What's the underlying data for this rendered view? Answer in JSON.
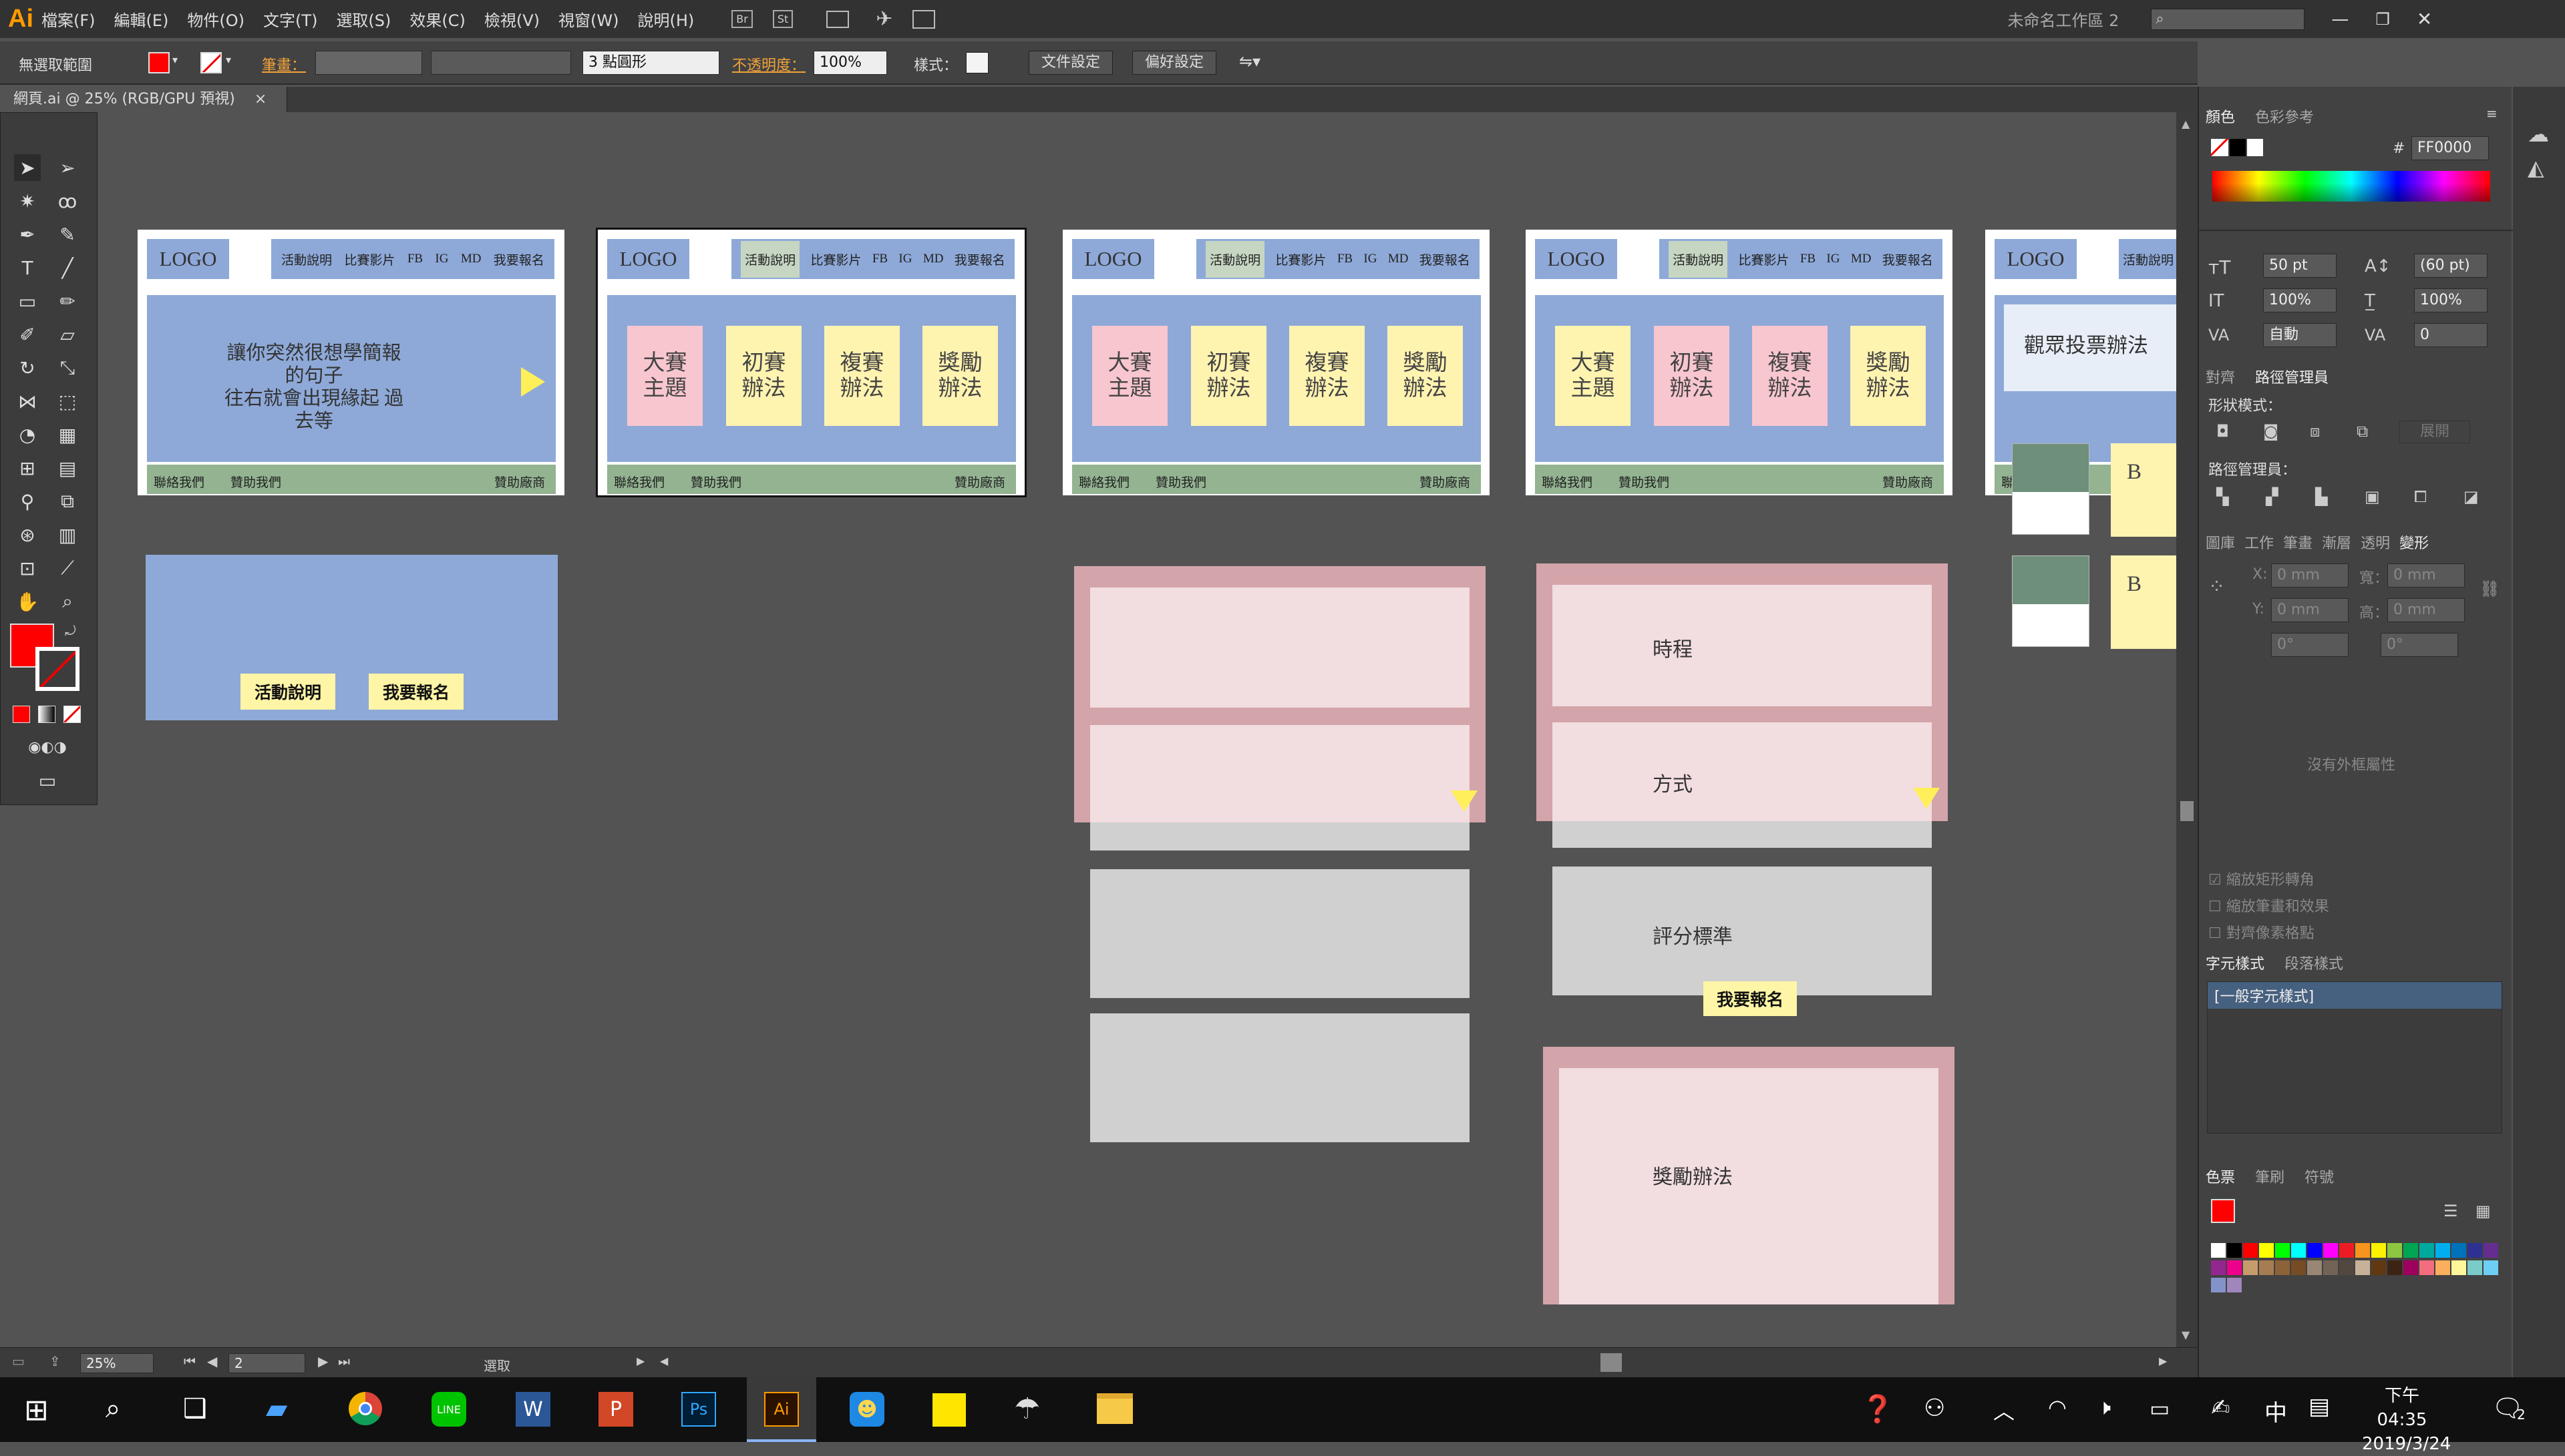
{
  "app": {
    "logo": "Ai",
    "doc_tab": "網頁.ai @ 25% (RGB/GPU 預視)",
    "tab_close": "×",
    "workspace": "未命名工作區 2"
  },
  "menus": [
    "檔案(F)",
    "編輯(E)",
    "物件(O)",
    "文字(T)",
    "選取(S)",
    "效果(C)",
    "檢視(V)",
    "視窗(W)",
    "說明(H)"
  ],
  "menubar_icons": {
    "br": "Br",
    "st": "St"
  },
  "control": {
    "selection": "無選取範圍",
    "stroke_label": "筆畫：",
    "brush": "3 點圓形",
    "opacity_label": "不透明度：",
    "opacity": "100%",
    "style_label": "樣式：",
    "doc_settings": "文件設定",
    "prefs": "偏好設定"
  },
  "pages": [
    {
      "logo": "LOGO",
      "nav": [
        "活動說明",
        "比賽影片",
        "FB",
        "IG",
        "MD",
        "我要報名"
      ],
      "hero_text": [
        "讓你突然很想學簡報的句子",
        "往右就會出現緣起 過去等"
      ],
      "foot_left": [
        "聯絡我們",
        "贊助我們"
      ],
      "foot_right": "贊助廠商"
    },
    {
      "logo": "LOGO",
      "nav": [
        "活動說明",
        "比賽影片",
        "FB",
        "IG",
        "MD",
        "我要報名"
      ],
      "cards": [
        "大賽\n主題",
        "初賽\n辦法",
        "複賽\n辦法",
        "獎勵\n辦法"
      ],
      "foot_left": [
        "聯絡我們",
        "贊助我們"
      ],
      "foot_right": "贊助廠商"
    },
    {
      "logo": "LOGO",
      "nav": [
        "活動說明",
        "比賽影片",
        "FB",
        "IG",
        "MD",
        "我要報名"
      ],
      "cards": [
        "大賽\n主題",
        "初賽\n辦法",
        "複賽\n辦法",
        "獎勵\n辦法"
      ],
      "foot_left": [
        "聯絡我們",
        "贊助我們"
      ],
      "foot_right": "贊助廠商"
    },
    {
      "logo": "LOGO",
      "nav": [
        "活動說明",
        "比賽影片",
        "FB",
        "IG",
        "MD",
        "我要報名"
      ],
      "cards": [
        "大賽\n主題",
        "初賽\n辦法",
        "複賽\n辦法",
        "獎勵\n辦法"
      ],
      "foot_left": [
        "聯絡我們",
        "贊助我們"
      ],
      "foot_right": "贊助廠商"
    },
    {
      "logo": "LOGO",
      "nav": [
        "活動說明"
      ],
      "hero_text": [
        "觀眾投票辦法"
      ],
      "foot_left": [
        "聯絡我們"
      ]
    }
  ],
  "mobile": {
    "buttons": [
      "活動說明",
      "我要報名"
    ]
  },
  "schedule": {
    "labels": [
      "時程",
      "方式",
      "評分標準",
      "獎勵辦法"
    ],
    "button": "我要報名"
  },
  "b_labels": [
    "B",
    "B"
  ],
  "colors": {
    "nav_blue": "#8ea9d8",
    "footer_green": "#93b391",
    "pink": "#f8c6cf",
    "yellow": "#fff3b0",
    "button_yellow": "#fff5a6",
    "fill": "#FF0000"
  },
  "panels": {
    "color_tabs": [
      "顏色",
      "色彩參考"
    ],
    "hex_label": "#",
    "hex": "FF0000",
    "char": {
      "size": "50 pt",
      "leading": "(60 pt)",
      "hscale": "100%",
      "vscale": "100%",
      "kern": "自動",
      "track": "0"
    },
    "align_tabs": [
      "對齊",
      "路徑管理員"
    ],
    "shape_mode": "形狀模式：",
    "expand": "展開",
    "pathfinder": "路徑管理員：",
    "transform_tabs": [
      "圖庫",
      "工作",
      "筆畫",
      "漸層",
      "透明",
      "變形"
    ],
    "transform": {
      "x_label": "X:",
      "x": "0 mm",
      "w_label": "寬：",
      "w": "0 mm",
      "y_label": "Y:",
      "y": "0 mm",
      "h_label": "高：",
      "h": "0 mm",
      "rot": "0°",
      "shear": "0°"
    },
    "no_appearance": "沒有外框屬性",
    "checks": [
      "縮放矩形轉角",
      "縮放筆畫和效果",
      "對齊像素格點"
    ],
    "char_style_tabs": [
      "字元樣式",
      "段落樣式"
    ],
    "char_style_item": "[一般字元樣式]",
    "swatch_tabs": [
      "色票",
      "筆刷",
      "符號"
    ]
  },
  "status": {
    "zoom": "25%",
    "artboard": "2",
    "tool": "選取"
  },
  "taskbar": {
    "ime": "中",
    "time": "下午 04:35",
    "date": "2019/3/24",
    "notif": "2"
  }
}
